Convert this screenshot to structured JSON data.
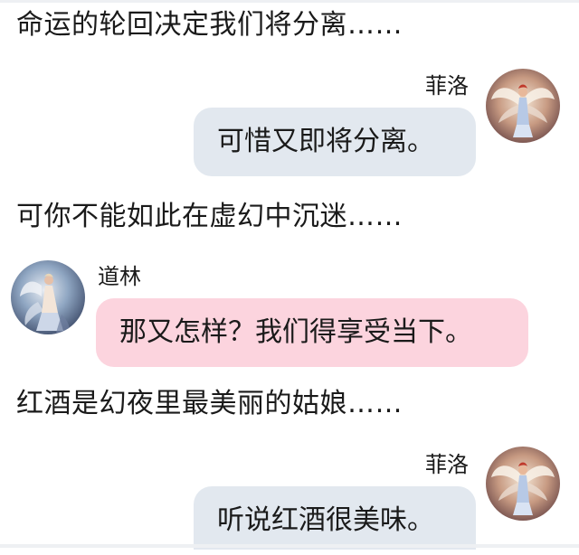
{
  "narration": [
    "命运的轮回决定我们将分离……",
    "可你不能如此在虚幻中沉迷……",
    "红酒是幻夜里最美丽的姑娘……"
  ],
  "messages": [
    {
      "name": "菲洛",
      "text": "可惜又即将分离。"
    },
    {
      "name": "道林",
      "text": "那又怎样？我们得享受当下。"
    },
    {
      "name": "菲洛",
      "text": "听说红酒很美味。"
    }
  ],
  "colors": {
    "gray_bubble": "#e2e8ef",
    "pink_bubble": "#fcd4de"
  },
  "icons": {
    "filo_avatar": "winged-angel-figure-avatar",
    "dorian_avatar": "angel-figure-avatar"
  }
}
